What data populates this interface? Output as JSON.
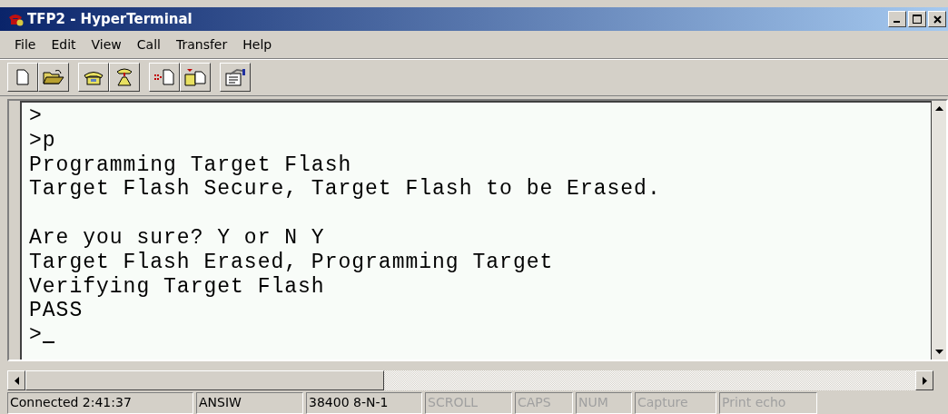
{
  "window": {
    "title": "TFP2 - HyperTerminal"
  },
  "menu": [
    "File",
    "Edit",
    "View",
    "Call",
    "Transfer",
    "Help"
  ],
  "toolbar": [
    {
      "kind": "new"
    },
    {
      "kind": "open"
    },
    {
      "kind": "sep"
    },
    {
      "kind": "phone"
    },
    {
      "kind": "hangup"
    },
    {
      "kind": "sep"
    },
    {
      "kind": "send"
    },
    {
      "kind": "receive"
    },
    {
      "kind": "sep"
    },
    {
      "kind": "properties"
    }
  ],
  "terminal": {
    "blocks": [
      {
        "lines": [
          {
            "text": ">",
            "cursor": false
          },
          {
            "text": ">p",
            "cursor": false
          },
          {
            "text": "Programming Target Flash",
            "cursor": false
          },
          {
            "text": "Target Flash Secure, Target Flash to be Erased.",
            "cursor": false
          }
        ]
      },
      {
        "lines": [
          {
            "text": "Are you sure? Y or N Y",
            "cursor": false
          },
          {
            "text": "Target Flash Erased, Programming Target",
            "cursor": false
          },
          {
            "text": "Verifying Target Flash",
            "cursor": false
          },
          {
            "text": "PASS",
            "cursor": false
          },
          {
            "text": ">",
            "cursor": true
          }
        ]
      }
    ]
  },
  "status_bar": [
    {
      "text": "Connected 2:41:37",
      "disabled": false
    },
    {
      "text": "ANSIW",
      "disabled": false
    },
    {
      "text": "38400 8-N-1",
      "disabled": false
    },
    {
      "text": "SCROLL",
      "disabled": true
    },
    {
      "text": "CAPS",
      "disabled": true
    },
    {
      "text": "NUM",
      "disabled": true
    },
    {
      "text": "Capture",
      "disabled": true
    },
    {
      "text": "Print echo",
      "disabled": true
    }
  ]
}
